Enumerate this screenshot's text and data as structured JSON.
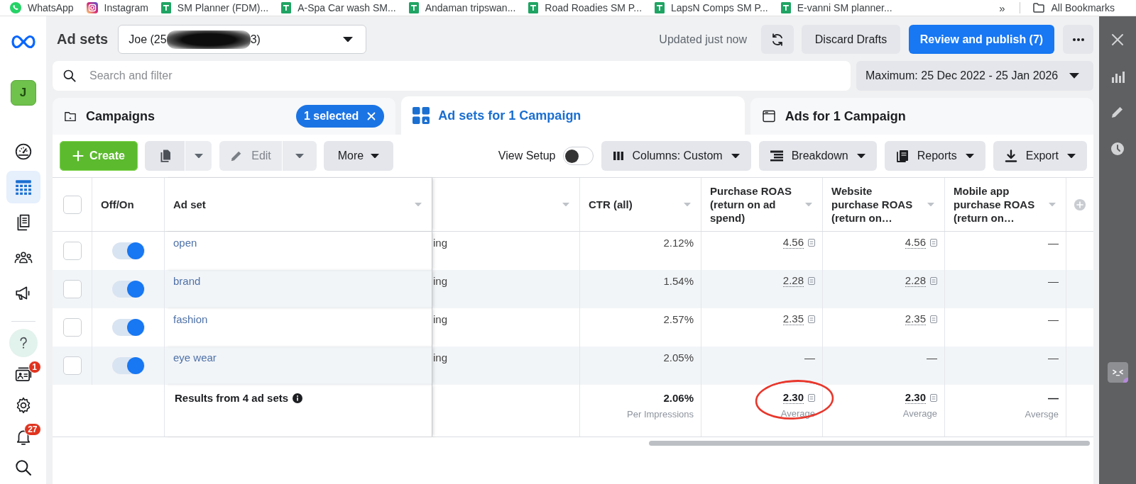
{
  "bookmarks": {
    "items": [
      {
        "label": "WhatsApp",
        "kind": "whatsapp"
      },
      {
        "label": "Instagram",
        "kind": "instagram"
      },
      {
        "label": "SM Planner (FDM)...",
        "kind": "sheet"
      },
      {
        "label": "A-Spa Car wash SM...",
        "kind": "sheet"
      },
      {
        "label": "Andaman tripswan...",
        "kind": "sheet"
      },
      {
        "label": "Road Roadies SM P...",
        "kind": "sheet"
      },
      {
        "label": "LapsN Comps SM P...",
        "kind": "sheet"
      },
      {
        "label": "E-vanni SM planner...",
        "kind": "sheet"
      }
    ],
    "more": "»",
    "all_bookmarks": "All Bookmarks"
  },
  "nav_rail": {
    "avatar": "J",
    "items": [
      {
        "kind": "gauge",
        "selected": false
      },
      {
        "kind": "table",
        "selected": true
      },
      {
        "kind": "pages",
        "selected": false
      },
      {
        "kind": "people",
        "selected": false
      },
      {
        "kind": "megaphone",
        "selected": false
      }
    ],
    "bottom_items": [
      {
        "kind": "help"
      },
      {
        "kind": "contact",
        "badge": "1"
      },
      {
        "kind": "gear"
      },
      {
        "kind": "bell",
        "badge": "27"
      },
      {
        "kind": "search"
      }
    ]
  },
  "header": {
    "title": "Ad sets",
    "account": {
      "text_before": "Joe (25",
      "redacted": true,
      "text_after": "3)"
    },
    "status": "Updated just now",
    "discard": "Discard Drafts",
    "publish": "Review and publish (7)"
  },
  "search": {
    "placeholder": "Search and filter"
  },
  "date_range": {
    "label": "Maximum: 25 Dec 2022 - 25 Jan 2026"
  },
  "tabs": [
    {
      "label": "Campaigns",
      "kind": "campaigns",
      "selected": false,
      "chip": "1 selected"
    },
    {
      "label": "Ad sets for 1 Campaign",
      "kind": "adsets",
      "selected": true
    },
    {
      "label": "Ads for 1 Campaign",
      "kind": "ads",
      "selected": false
    }
  ],
  "toolbar": {
    "create": "Create",
    "edit": {
      "label": "Edit",
      "disabled": true
    },
    "more": "More",
    "view_setup": {
      "label": "View Setup",
      "on": false
    },
    "menus": [
      {
        "label": "Columns: Custom",
        "kind": "columns"
      },
      {
        "label": "Breakdown",
        "kind": "breakdown"
      },
      {
        "label": "Reports",
        "kind": "reports"
      },
      {
        "label": "Export",
        "kind": "export"
      }
    ]
  },
  "table": {
    "all_selected": false,
    "columns": [
      {
        "label": "Off/On",
        "kind": "toggle"
      },
      {
        "label": "Ad set",
        "kind": "name"
      },
      {
        "kind": "text"
      },
      {
        "label": "CTR (all)",
        "kind": "metric"
      },
      {
        "label": "Purchase ROAS (return on ad spend)",
        "kind": "roas"
      },
      {
        "label": "Website purchase ROAS (return on…",
        "kind": "roas"
      },
      {
        "label": "Mobile app purchase ROAS (return on…",
        "kind": "roas"
      }
    ],
    "rows": [
      {
        "selected": false,
        "on": true,
        "name": "open",
        "cells": [
          {
            "text": "ing"
          },
          {
            "text": "2.12%"
          },
          {
            "text": "4.56",
            "note": true
          },
          {
            "text": "4.56",
            "note": true
          },
          {
            "text": "—",
            "note": false
          }
        ]
      },
      {
        "selected": false,
        "on": true,
        "name": "brand",
        "cells": [
          {
            "text": "ing"
          },
          {
            "text": "1.54%"
          },
          {
            "text": "2.28",
            "note": true
          },
          {
            "text": "2.28",
            "note": true
          },
          {
            "text": "—",
            "note": false
          }
        ]
      },
      {
        "selected": false,
        "on": true,
        "name": "fashion",
        "cells": [
          {
            "text": "ing"
          },
          {
            "text": "2.57%"
          },
          {
            "text": "2.35",
            "note": true
          },
          {
            "text": "2.35",
            "note": true
          },
          {
            "text": "—",
            "note": false
          }
        ]
      },
      {
        "selected": false,
        "on": true,
        "name": "eye wear",
        "cells": [
          {
            "text": "ing"
          },
          {
            "text": "2.05%"
          },
          {
            "text": "—",
            "note": false
          },
          {
            "text": "—",
            "note": false
          },
          {
            "text": "—",
            "note": false
          }
        ]
      }
    ],
    "summary": {
      "label": "Results from 4 ad sets",
      "metrics": [
        {
          "value": "2.06%",
          "caption": "Per Impressions",
          "note": false,
          "circled": false
        },
        {
          "value": "2.30",
          "caption": "Average",
          "note": true,
          "circled": true
        },
        {
          "value": "2.30",
          "caption": "Average",
          "note": true,
          "circled": false
        },
        {
          "value": "—",
          "caption": "Aversge",
          "note": false,
          "circled": false
        }
      ]
    }
  }
}
